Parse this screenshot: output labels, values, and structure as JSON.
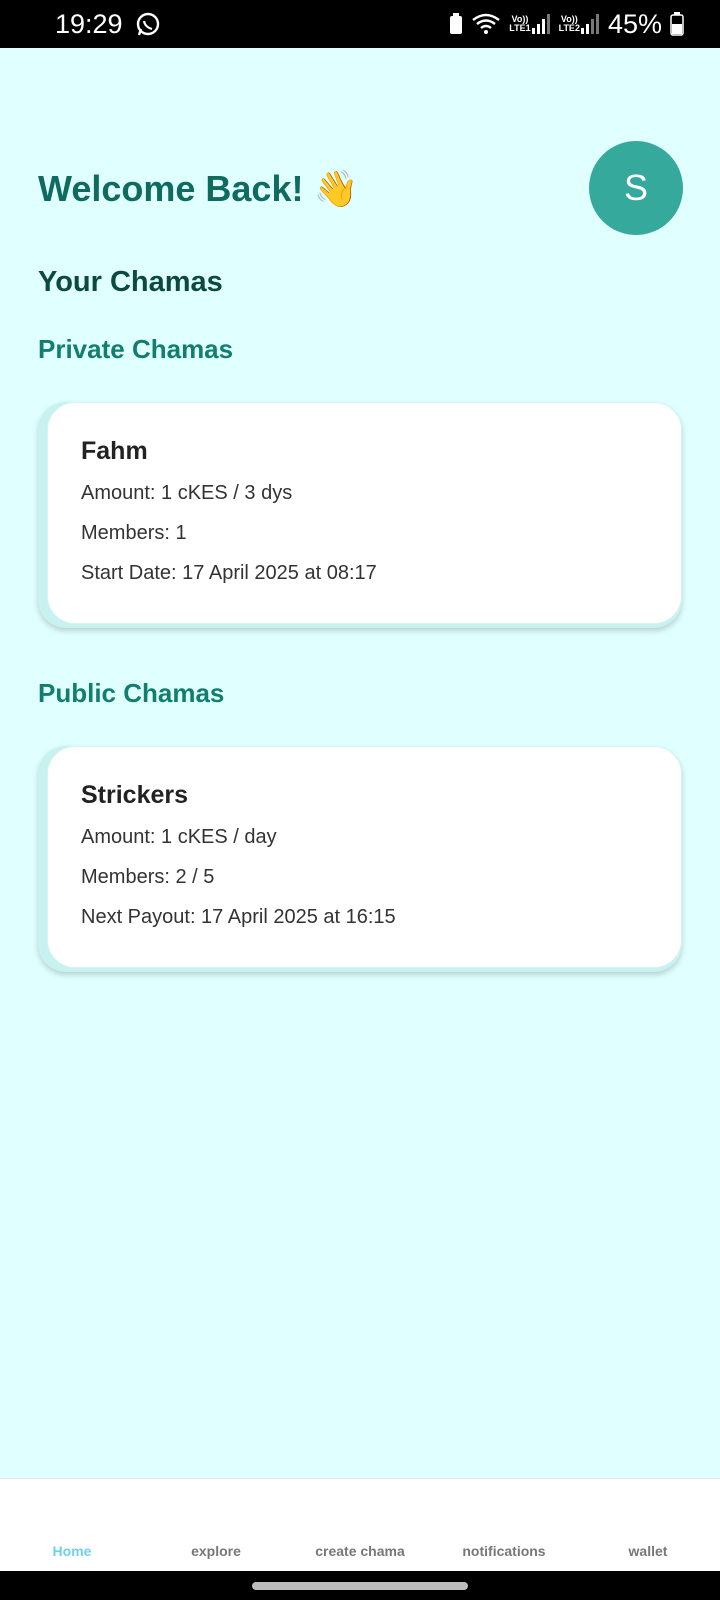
{
  "status_bar": {
    "time": "19:29",
    "battery_percent": "45%",
    "sim1_label": "LTE1",
    "sim2_label": "LTE2",
    "volte1": "Vo))",
    "volte2": "Vo))",
    "icons": [
      "whatsapp-icon",
      "battery-saver-icon",
      "wifi-icon",
      "signal-icon",
      "battery-icon"
    ]
  },
  "header": {
    "welcome": "Welcome Back!",
    "wave_emoji": "👋",
    "avatar_initial": "S"
  },
  "main": {
    "section_title": "Your Chamas",
    "private_title": "Private Chamas",
    "public_title": "Public Chamas",
    "private_chamas": [
      {
        "name": "Fahm",
        "amount": "Amount: 1 cKES / 3 dys",
        "members": "Members: 1",
        "date": "Start Date: 17 April 2025 at 08:17"
      }
    ],
    "public_chamas": [
      {
        "name": "Strickers",
        "amount": "Amount: 1 cKES / day",
        "members": "Members: 2 / 5",
        "date": "Next Payout: 17 April 2025 at 16:15"
      }
    ]
  },
  "bottom_nav": {
    "items": [
      {
        "label": "Home",
        "active": true
      },
      {
        "label": "explore",
        "active": false
      },
      {
        "label": "create chama",
        "active": false
      },
      {
        "label": "notifications",
        "active": false
      },
      {
        "label": "wallet",
        "active": false
      }
    ]
  },
  "colors": {
    "background": "#e0ffff",
    "accent": "#0f6b5f",
    "avatar": "#36a99d",
    "active_tab": "#6fd3e8"
  }
}
